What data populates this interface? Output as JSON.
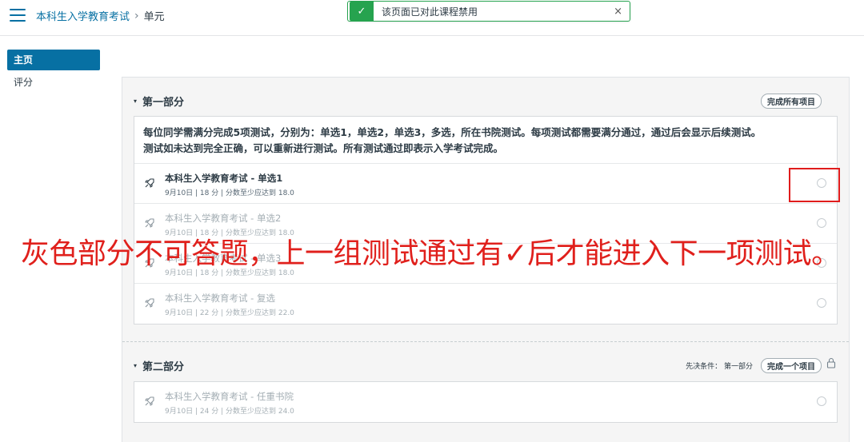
{
  "header": {
    "breadcrumb": [
      {
        "label": "本科生入学教育考试"
      },
      {
        "label": "单元"
      }
    ],
    "breadcrumb_sep": "›"
  },
  "toast": {
    "message": "该页面已对此课程禁用",
    "check": "✓",
    "close": "×"
  },
  "sidebar": {
    "items": [
      {
        "label": "主页",
        "active": true
      },
      {
        "label": "评分",
        "active": false
      }
    ]
  },
  "modules": [
    {
      "title": "第一部分",
      "caret": "▾",
      "requirement": "完成所有项目",
      "description_lines": [
        "每位同学需满分完成5项测试，分别为：单选1，单选2，单选3，多选，所在书院测试。每项测试都需要满分通过，通过后会显示后续测试。",
        "测试如未达到完全正确，可以重新进行测试。所有测试通过即表示入学考试完成。"
      ],
      "items": [
        {
          "title": "本科生入学教育考试 - 单选1",
          "meta": "9月10日 | 18 分 | 分数至少应达到 18.0",
          "locked": false
        },
        {
          "title": "本科生入学教育考试 - 单选2",
          "meta": "9月10日 | 18 分 | 分数至少应达到 18.0",
          "locked": true
        },
        {
          "title": "本科生入学教育考试 - 单选3",
          "meta": "9月10日 | 18 分 | 分数至少应达到 18.0",
          "locked": true
        },
        {
          "title": "本科生入学教育考试 - 复选",
          "meta": "9月10日 | 22 分 | 分数至少应达到 22.0",
          "locked": true
        }
      ]
    },
    {
      "title": "第二部分",
      "caret": "▾",
      "prerequisite": "先决条件：  第一部分",
      "requirement": "完成一个项目",
      "items": [
        {
          "title": "本科生入学教育考试 - 任重书院",
          "meta": "9月10日 | 24 分 | 分数至少应达到 24.0",
          "locked": true
        }
      ]
    }
  ],
  "annotation": {
    "text": "灰色部分不可答题，上一组测试通过有✓后才能进入下一项测试。",
    "color": "#e0201c"
  },
  "colors": {
    "link": "#0770a3",
    "success": "#26a34f",
    "highlight": "#e01c1c"
  }
}
